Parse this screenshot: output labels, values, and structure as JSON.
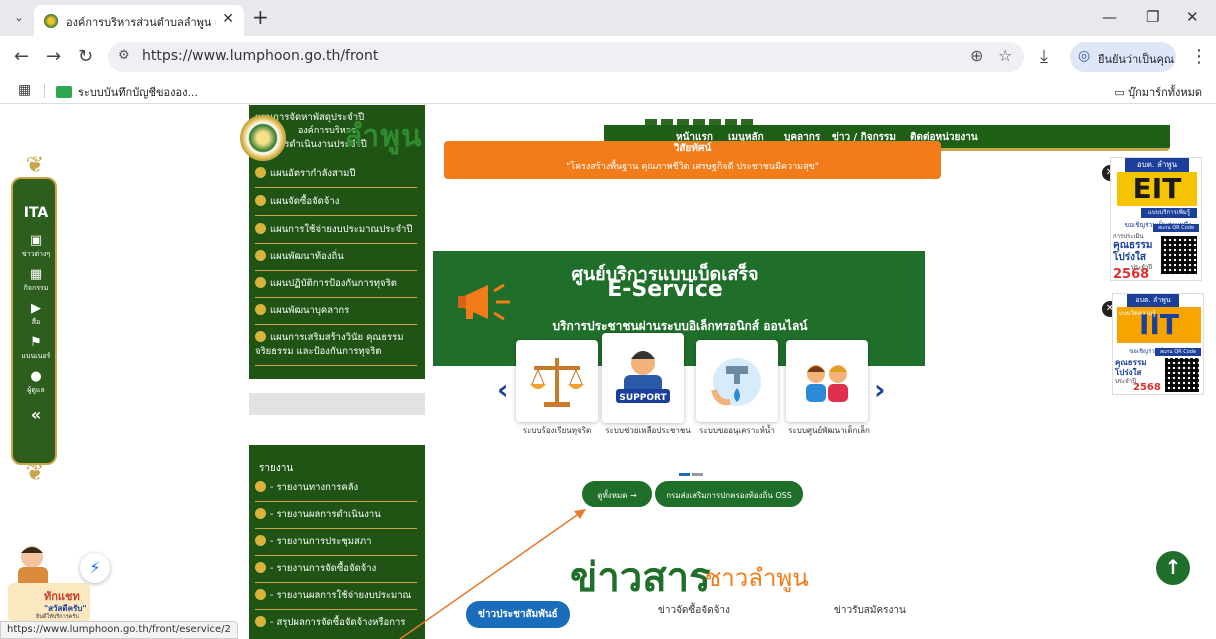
{
  "browser": {
    "tab_title": "องค์การบริหารส่วนตำบลลำพูน เลขที่",
    "tab_close": "✕",
    "new_tab": "+",
    "url": "https://www.lumphoon.go.th/front",
    "profile_label": "ยืนยันว่าเป็นคุณ",
    "bookmark_item": "ระบบบันทึกบัญชีขององ...",
    "all_bookmarks": "บุ๊กมาร์กทั้งหมด"
  },
  "ita": {
    "title": "ITA",
    "items": [
      {
        "icon": "▣",
        "label": "ข่าวต่างๆ"
      },
      {
        "icon": "▦",
        "label": "กิจกรรม"
      },
      {
        "icon": "▶",
        "label": "สื่อ"
      },
      {
        "icon": "⚑",
        "label": "แบนเนอร์"
      },
      {
        "icon": "●",
        "label": "ผู้ดูแล"
      }
    ],
    "collapse": "«"
  },
  "header": {
    "brand": "ลำพูน",
    "sub_line1": "แผนการจัดหาพัสดุประจำปี",
    "sub_line2": "องค์การบริหาร",
    "sub_line3": "แผนการดำเนินงานประจำปี",
    "en_name": "ส่วนตำบลลำพูน",
    "nav": [
      "หน้าแรก",
      "เมนูหลัก",
      "บุคลากร",
      "ข่าว / กิจกรรม",
      "ติดต่อหน่วยงาน"
    ]
  },
  "slogan": {
    "heading": "วิสัยทัศน์",
    "text": "\"โครงสร้างพื้นฐาน คุณภาพชีวิต เศรษฐกิจดี ประชาชนมีความสุข\""
  },
  "menu_plans": [
    "แผนอัตรากำลังสามปี",
    "แผนจัดซื้อจัดจ้าง",
    "แผนการใช้จ่ายงบประมาณประจำปี",
    "แผนพัฒนาท้องถิ่น",
    "แผนปฏิบัติการป้องกันการทุจริต",
    "แผนพัฒนาบุคลากร",
    "แผนการเสริมสร้างวินัย คุณธรรม จริยธรรม และป้องกันการทุจริต"
  ],
  "menu_reports": {
    "heading": "รายงาน",
    "items": [
      "- รายงานทางการคลัง",
      "- รายงานผลการดำเนินงาน",
      "- รายงานการประชุมสภา",
      "- รายงานการจัดซื้อจัดจ้าง",
      "- รายงานผลการใช้จ่ายงบประมาณ",
      "- สรุปผลการจัดซื้อจัดจ้างหรือการ"
    ]
  },
  "eservice": {
    "title1": "ศูนย์บริการแบบเบ็ดเสร็จ",
    "title2": "E-Service",
    "subtitle": "บริการประชาชนผ่านระบบอิเล็กทรอนิกส์ ออนไลน์",
    "cards": [
      {
        "label": "ระบบร้องเรียนทุจริต",
        "icon": "scales-icon"
      },
      {
        "label": "ระบบช่วยเหลือประชาชน",
        "icon": "support-icon"
      },
      {
        "label": "ระบบขออนุเคราะห์น้ำ",
        "icon": "water-tap-icon"
      },
      {
        "label": "ระบบศูนย์พัฒนาเด็กเล็ก",
        "icon": "children-icon"
      }
    ],
    "support_text": "SUPPORT",
    "prev": "‹",
    "next": "›",
    "view_all": "ดูทั้งหมด →",
    "oss": "กรมส่งเสริมการปกครองท้องถิ่น OSS"
  },
  "news": {
    "heading": "ข่าวสาร",
    "heading_sub": "ชาวลำพูน",
    "tabs": [
      "ข่าวประชาสัมพันธ์",
      "ข่าวจัดซื้อจัดจ้าง",
      "ข่าวรับสมัครงาน"
    ]
  },
  "badges": {
    "eit": {
      "top": "อบต. ลำพูน",
      "title": "EIT",
      "tag": "แบบบริการเพิ่มรู้",
      "invite": "ขอเชิญร่วมเป็นส่วนหนึ่ง",
      "line1": "การประเมิน",
      "line2": "คุณธรรม",
      "line3": "และความ",
      "line4": "โปร่งใส",
      "year_label": "ประจำปี",
      "year": "2568",
      "scan": "สแกน QR Code"
    },
    "iit": {
      "top": "อบต. ลำพูน",
      "title": "IIT",
      "tag": "แบบวัดความรู้",
      "invite": "ขอเชิญร่วมเป็นส่วนหนึ่ง",
      "line2": "คุณธรรม",
      "line4": "โปร่งใส",
      "year_label": "ประจำปี",
      "year": "2568",
      "scan": "สแกน QR Code"
    },
    "close": "✕"
  },
  "mascot": {
    "line1": "ทักแชท",
    "line2": "\"สวัสดีครับ\"",
    "line3": "ยินดีให้บริการครับ"
  },
  "status_url": "https://www.lumphoon.go.th/front/eservice/2",
  "colors": {
    "primary_green": "#1f6e2a",
    "dark_green": "#1f5415",
    "gold": "#c9a64c",
    "orange": "#f27c1a",
    "blue": "#1a6dbb"
  }
}
